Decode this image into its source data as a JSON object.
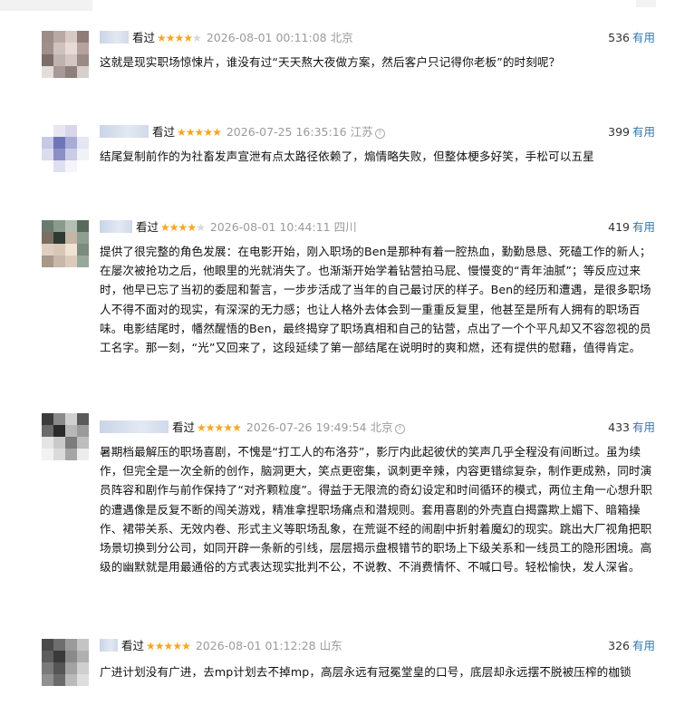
{
  "labels": {
    "watched": "看过",
    "useful": "有用",
    "stars_full": "★",
    "stars_empty": "★"
  },
  "reviews": [
    {
      "rating": 4,
      "time": "2026-08-01 00:11:08",
      "location": "北京",
      "votes": "536",
      "content": "这就是现实职场惊悚片，谁没有过“天天熬大夜做方案，然后客户只记得你老板”的时刻呢？",
      "avatar_colors": [
        "#9e8c88",
        "#b8a9a4",
        "#d7c9c4",
        "#8f7b77",
        "#a18f8a",
        "#cfc2bd",
        "#e8dbd6",
        "#b7a39e",
        "#7c6d6a",
        "#bfb3b0",
        "#d3c7c3",
        "#9a8a86",
        "#e5ddda",
        "#a79995",
        "#8c7f7c",
        "#d6cfcc"
      ]
    },
    {
      "rating": 5,
      "time": "2026-07-25 16:35:16",
      "location": "江苏",
      "info": "?",
      "votes": "399",
      "content": "结尾复制前作的为社畜发声宣泄有点太路径依赖了，煽情略失败，但整体梗多好笑，手松可以五星",
      "avatar_colors": [
        "#ffffff",
        "#e8e6f2",
        "#d9d6ea",
        "#ffffff",
        "#c7c9e6",
        "#6f76b8",
        "#a8acd7",
        "#e4e6f3",
        "#dadcef",
        "#8b8fc6",
        "#c8cce6",
        "#f1f1f8",
        "#ffffff",
        "#dedff0",
        "#f4f4fa",
        "#ffffff"
      ]
    },
    {
      "rating": 4,
      "time": "2026-08-01 10:44:11",
      "location": "四川",
      "votes": "419",
      "content": "提供了很完整的角色发展：在电影开始，刚入职场的Ben是那种有着一腔热血，勤勤恳恳、死磕工作的新人；在屡次被抢功之后，他眼里的光就消失了。也渐渐开始学着钻营拍马屁、慢慢变的“青年油腻”；等反应过来时，他早已忘了当初的委屈和誓言，一步步活成了当年的自己最讨厌的样子。Ben的经历和遭遇，是很多职场人不得不面对的现实，有深深的无力感；也让人格外去体会到一重重反复里，他甚至是所有人拥有的职场百味。电影结尾时，幡然醒悟的Ben，最终揭穿了职场真相和自己的钻营，点出了一个个平凡却又不容忽视的员工名字。那一刻，“光”又回来了，这段延续了第一部结尾在说明时的爽和燃，还有提供的慰藉，值得肯定。",
      "avatar_colors": [
        "#6b7c6e",
        "#8a9a8c",
        "#b3bfb4",
        "#596a5c",
        "#7d6e62",
        "#2f3a35",
        "#c4b5a6",
        "#8e9e90",
        "#e0cfc0",
        "#d9c7b6",
        "#f0e2d4",
        "#7b8b7e",
        "#a89889",
        "#c9b8a9",
        "#dccbbc",
        "#9aa89c"
      ]
    },
    {
      "rating": 5,
      "time": "2026-07-26 19:49:54",
      "location": "北京",
      "info": "?",
      "votes": "433",
      "content": "暑期档最解压的职场喜剧，不愧是“打工人的布洛芬”，影厅内此起彼伏的笑声几乎全程没有间断过。虽为续作，但完全是一次全新的创作，脑洞更大，笑点更密集，讽刺更辛辣，内容更错综复杂，制作更成熟，同时演员阵容和剧作与前作保持了“对齐颗粒度”。得益于无限流的奇幻设定和时间循环的模式，两位主角一心想升职的遭遇像是反复不断的闯关游戏，精准拿捏职场痛点和潜规则。套用喜剧的外壳直白揭露欺上媚下、暗箱操作、裙带关系、无效内卷、形式主义等职场乱象，在荒诞不经的闹剧中折射着魔幻的现实。跳出大厂视角把职场景切换到分公司，如同开辟一条新的引线，层层揭示盘根错节的职场上下级关系和一线员工的隐形困境。高级的幽默就是用最通俗的方式表达现实批判不公，不说教、不消费情怀、不喊口号。轻松愉快，发人深省。",
      "avatar_colors": [
        "#3c3c3c",
        "#8a8a8a",
        "#d0d0d0",
        "#5a5a5a",
        "#6b6b6b",
        "#2a2a2a",
        "#b8b8b8",
        "#9a9a9a",
        "#e4e4e4",
        "#c9c9c9",
        "#7c7c7c",
        "#bdbdbd",
        "#f2f2f2",
        "#dadada",
        "#a5a5a5",
        "#ececec"
      ]
    },
    {
      "rating": 5,
      "time": "2026-08-01 01:12:28",
      "location": "山东",
      "votes": "326",
      "content": "广进计划没有广进，去mp计划去不掉mp，高层永远有冠冕堂皇的口号，底层却永远摆不脱被压榨的枷锁",
      "avatar_colors": [
        "#4a4a4a",
        "#6e6e6e",
        "#9a9a9a",
        "#c4c4c4",
        "#5d5d5d",
        "#3a3a3a",
        "#8a8a8a",
        "#b0b0b0",
        "#7a7a7a",
        "#555555",
        "#a2a2a2",
        "#cfcfcf",
        "#909090",
        "#6a6a6a",
        "#bababa",
        "#dedede"
      ]
    }
  ]
}
